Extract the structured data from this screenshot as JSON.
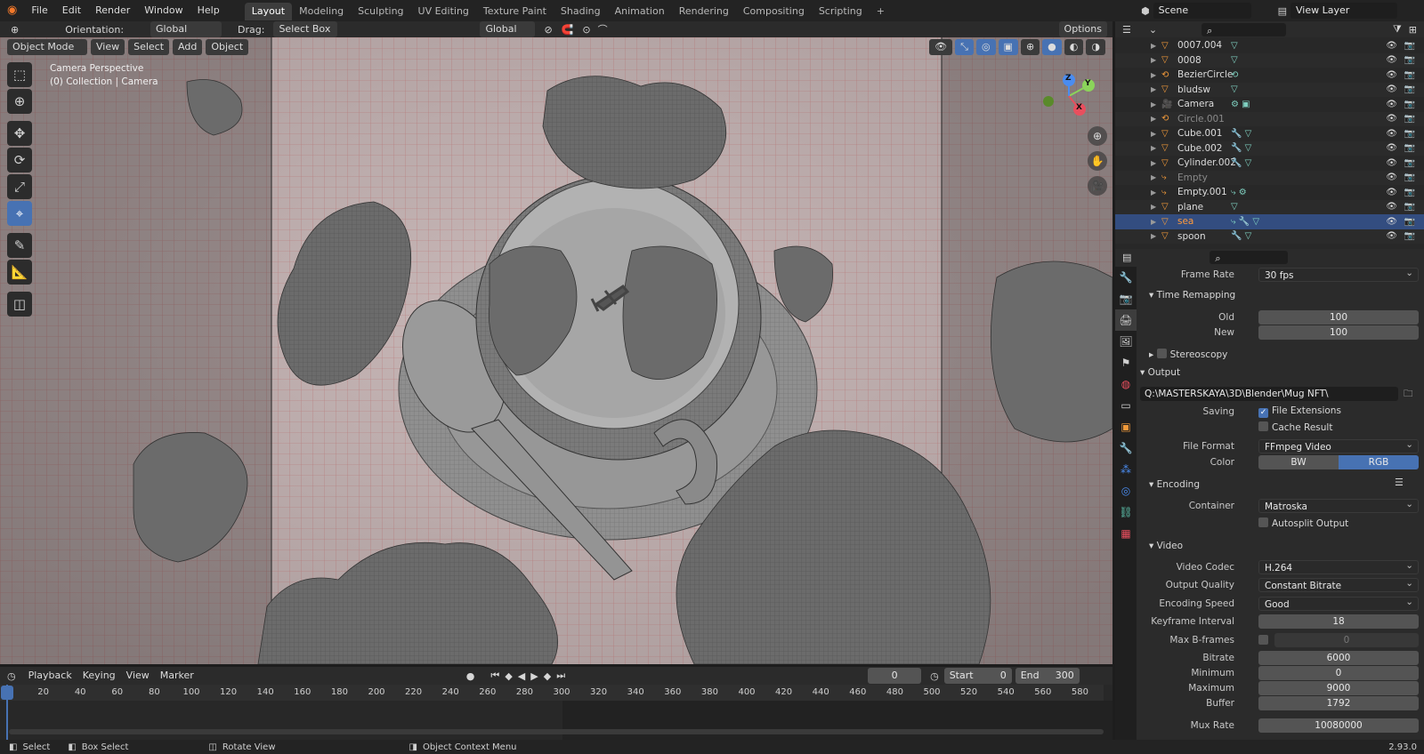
{
  "menu": [
    "File",
    "Edit",
    "Render",
    "Window",
    "Help"
  ],
  "workspaces": [
    {
      "label": "Layout",
      "active": true
    },
    {
      "label": "Modeling",
      "active": false
    },
    {
      "label": "Sculpting",
      "active": false
    },
    {
      "label": "UV Editing",
      "active": false
    },
    {
      "label": "Texture Paint",
      "active": false
    },
    {
      "label": "Shading",
      "active": false
    },
    {
      "label": "Animation",
      "active": false
    },
    {
      "label": "Rendering",
      "active": false
    },
    {
      "label": "Compositing",
      "active": false
    },
    {
      "label": "Scripting",
      "active": false
    }
  ],
  "add_workspace": "+",
  "scene": "Scene",
  "view_layer": "View Layer",
  "tool_header": {
    "orientation_label": "Orientation:",
    "orientation_value": "Global",
    "drag_label": "Drag:",
    "drag_value": "Select Box",
    "transform_orientation": "Global",
    "options": "Options"
  },
  "viewport_header": {
    "mode": "Object Mode",
    "view": "View",
    "select": "Select",
    "add": "Add",
    "object": "Object"
  },
  "viewport_overlay": {
    "line1": "Camera Perspective",
    "line2": "(0) Collection | Camera"
  },
  "gizmo": {
    "x": "X",
    "y": "Y",
    "z": "Z"
  },
  "accent": "#4772b3",
  "outliner": [
    {
      "name": "0007.004",
      "icon": "mesh-icon",
      "mods": "▽",
      "state": ""
    },
    {
      "name": "0008",
      "icon": "mesh-icon",
      "mods": "▽",
      "state": ""
    },
    {
      "name": "BezierCircle",
      "icon": "curve-icon",
      "mods": "⟲",
      "state": ""
    },
    {
      "name": "bludsw",
      "icon": "mesh-icon",
      "mods": "▽",
      "state": ""
    },
    {
      "name": "Camera",
      "icon": "camera-icon",
      "mods": "⚙ ▣",
      "state": ""
    },
    {
      "name": "Circle.001",
      "icon": "curve-icon",
      "mods": "",
      "state": "dim"
    },
    {
      "name": "Cube.001",
      "icon": "mesh-icon",
      "mods": "🔧 ▽",
      "state": ""
    },
    {
      "name": "Cube.002",
      "icon": "mesh-icon",
      "mods": "🔧 ▽",
      "state": ""
    },
    {
      "name": "Cylinder.002",
      "icon": "mesh-icon",
      "mods": "🔧 ▽",
      "state": ""
    },
    {
      "name": "Empty",
      "icon": "empty-icon",
      "mods": "",
      "state": "dim"
    },
    {
      "name": "Empty.001",
      "icon": "empty-icon",
      "mods": "⤷ ⚙",
      "state": ""
    },
    {
      "name": "plane",
      "icon": "mesh-icon",
      "mods": "▽",
      "state": ""
    },
    {
      "name": "sea",
      "icon": "mesh-icon",
      "mods": "⤷ 🔧 ▽",
      "state": "sel"
    },
    {
      "name": "spoon",
      "icon": "mesh-icon",
      "mods": "🔧 ▽",
      "state": ""
    }
  ],
  "properties": {
    "frame_rate_label": "Frame Rate",
    "frame_rate_value": "30 fps",
    "time_remapping": "Time Remapping",
    "old_label": "Old",
    "old_value": "100",
    "new_label": "New",
    "new_value": "100",
    "stereoscopy": "Stereoscopy",
    "output": "Output",
    "output_path": "Q:\\MASTERSKAYA\\3D\\Blender\\Mug NFT\\",
    "saving_label": "Saving",
    "file_extensions": "File Extensions",
    "cache_result": "Cache Result",
    "file_format_label": "File Format",
    "file_format_value": "FFmpeg Video",
    "color_label": "Color",
    "color_bw": "BW",
    "color_rgb": "RGB",
    "encoding": "Encoding",
    "container_label": "Container",
    "container_value": "Matroska",
    "autosplit": "Autosplit Output",
    "video": "Video",
    "video_codec_label": "Video Codec",
    "video_codec_value": "H.264",
    "output_quality_label": "Output Quality",
    "output_quality_value": "Constant Bitrate",
    "encoding_speed_label": "Encoding Speed",
    "encoding_speed_value": "Good",
    "keyframe_interval_label": "Keyframe Interval",
    "keyframe_interval_value": "18",
    "max_bframes_label": "Max B-frames",
    "max_bframes_value": "0",
    "bitrate_label": "Bitrate",
    "bitrate_value": "6000",
    "minimum_label": "Minimum",
    "minimum_value": "0",
    "maximum_label": "Maximum",
    "maximum_value": "9000",
    "buffer_label": "Buffer",
    "buffer_value": "1792",
    "mux_rate_label": "Mux Rate",
    "mux_rate_value": "10080000"
  },
  "timeline": {
    "playback": "Playback",
    "keying": "Keying",
    "view": "View",
    "marker": "Marker",
    "current_frame": "0",
    "start_label": "Start",
    "start_value": "0",
    "end_label": "End",
    "end_value": "300",
    "ticks": [
      "0",
      "20",
      "40",
      "60",
      "80",
      "100",
      "120",
      "140",
      "160",
      "180",
      "200",
      "220",
      "240",
      "260",
      "280",
      "300",
      "320",
      "340",
      "360",
      "380",
      "400",
      "420",
      "440",
      "460",
      "480",
      "500",
      "520",
      "540",
      "560",
      "580"
    ]
  },
  "status": {
    "select": "Select",
    "box_select": "Box Select",
    "rotate_view": "Rotate View",
    "context_menu": "Object Context Menu",
    "version": "2.93.0"
  }
}
